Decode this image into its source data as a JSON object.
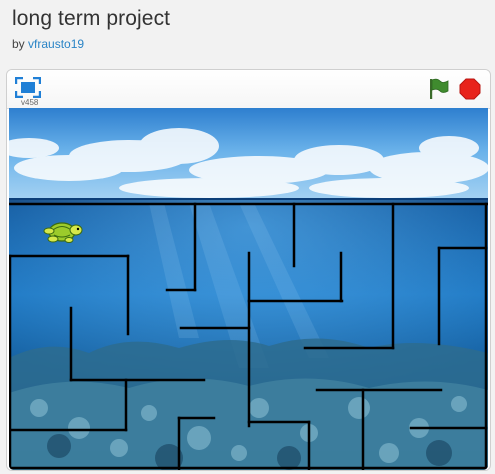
{
  "project": {
    "title": "long term project",
    "by_prefix": "by ",
    "author": "vfrausto19"
  },
  "player": {
    "version": "v458",
    "fullscreen_icon": "fullscreen-icon",
    "green_flag_icon": "green-flag-icon",
    "stop_icon": "stop-sign-icon",
    "colors": {
      "fullscreen": "#1f7fd6",
      "flag": "#3f8b2e",
      "stop": "#e8231b"
    }
  },
  "stage": {
    "sprite": "turtle",
    "sky_color": "#5aa9e6",
    "water_color": "#0d5fa8",
    "wall_color": "#000000"
  }
}
